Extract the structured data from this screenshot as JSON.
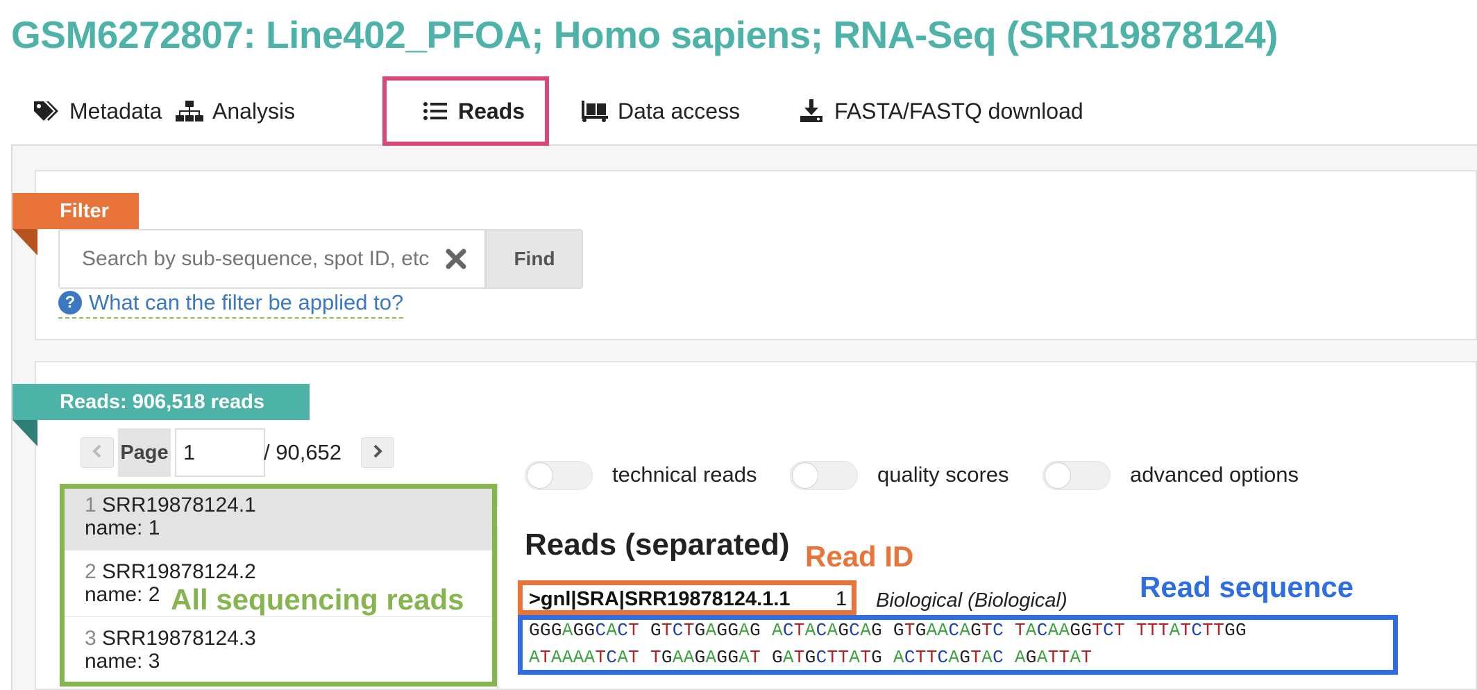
{
  "title": "GSM6272807: Line402_PFOA; Homo sapiens; RNA-Seq (SRR19878124)",
  "tabs": [
    {
      "label": "Metadata",
      "icon": "tags-icon"
    },
    {
      "label": "Analysis",
      "icon": "sitemap-icon"
    },
    {
      "label": "Reads",
      "icon": "list-icon",
      "active": true
    },
    {
      "label": "Data access",
      "icon": "dolly-icon"
    },
    {
      "label": "FASTA/FASTQ download",
      "icon": "download-icon"
    }
  ],
  "filter": {
    "label": "Filter",
    "placeholder": "Search by sub-sequence, spot ID, etc",
    "find_label": "Find",
    "help_text": "What can the filter be applied to?"
  },
  "reads_panel": {
    "label": "Reads: 906,518 reads",
    "page_label": "Page",
    "page_value": "1",
    "page_total": "/ 90,652",
    "items": [
      {
        "num": "1",
        "id": "SRR19878124.1",
        "name": "name: 1"
      },
      {
        "num": "2",
        "id": "SRR19878124.2",
        "name": "name: 2"
      },
      {
        "num": "3",
        "id": "SRR19878124.3",
        "name": "name: 3"
      }
    ]
  },
  "toggles": [
    {
      "label": "technical reads",
      "on": false
    },
    {
      "label": "quality scores",
      "on": false
    },
    {
      "label": "advanced options",
      "on": false
    }
  ],
  "reads_section": {
    "heading": "Reads (separated)",
    "read_id": ">gnl|SRA|SRR19878124.1.1",
    "spot": "1",
    "type": "Biological (Biological)",
    "sequence_line1": "GGGAGGCACT GTCTGAGGAG ACTACAGCAG GTGAACAGTC TACAAGGTCT TTTATCTTGG",
    "sequence_line2": "ATAAAATCAT TGAAGAGGAT GATGCTTATG ACTTCAGTAC AGATTAT"
  },
  "annotations": {
    "all_reads": "All sequencing reads",
    "read_id": "Read ID",
    "read_sequence": "Read sequence"
  },
  "colors": {
    "title": "#4db3a8",
    "filter_ribbon": "#e8743a",
    "reads_ribbon": "#4db3a8",
    "active_tab_box": "#d8487b",
    "annotation_green": "#86b44e",
    "annotation_orange": "#e8743a",
    "annotation_blue": "#2f6ee0",
    "nucleotide_A": "#3aa33a",
    "nucleotide_C": "#1f3fb5",
    "nucleotide_G": "#222222",
    "nucleotide_T": "#b52020"
  }
}
